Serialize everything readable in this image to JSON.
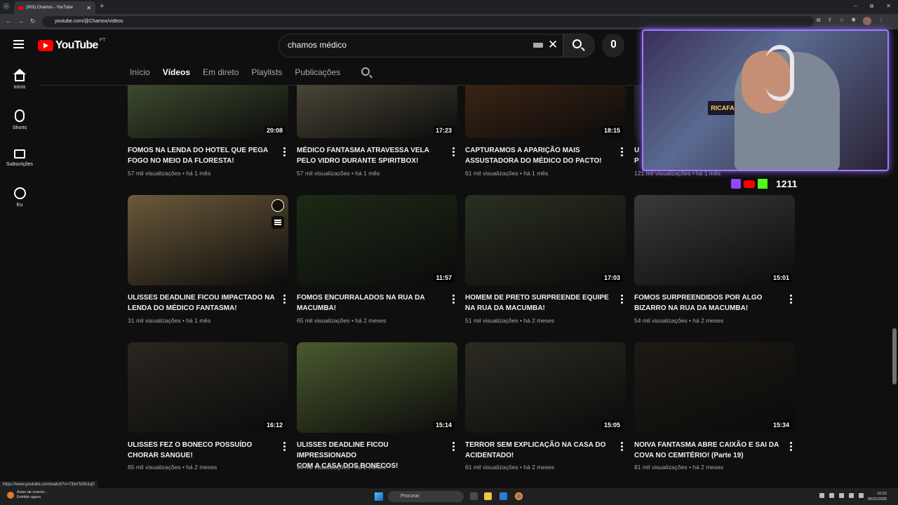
{
  "browser": {
    "tab_title": "(903) Chamos - YouTube",
    "url": "youtube.com/@Chamos/videos",
    "new_tab": "+",
    "tab_close": "✕",
    "win_min": "–",
    "win_max": "⧉",
    "win_close": "✕"
  },
  "header": {
    "logo_text": "YouTube",
    "logo_region": "PT",
    "search_value": "chamos médico"
  },
  "sidebar": {
    "items": [
      {
        "label": "Início",
        "icon": "home-icon"
      },
      {
        "label": "Shorts",
        "icon": "shorts-icon"
      },
      {
        "label": "Subscrições",
        "icon": "subscriptions-icon"
      },
      {
        "label": "Eu",
        "icon": "you-icon"
      }
    ]
  },
  "channel_tabs": [
    {
      "label": "Início",
      "active": false
    },
    {
      "label": "Vídeos",
      "active": true
    },
    {
      "label": "Em direto",
      "active": false
    },
    {
      "label": "Playlists",
      "active": false
    },
    {
      "label": "Publicações",
      "active": false
    }
  ],
  "videos": [
    {
      "title_1": "FOMOS NA LENDA DO HOTEL QUE PEGA",
      "title_2": "FOGO NO MEIO DA FLORESTA!",
      "views": "57 mil visualizações",
      "age": "há 1 mês",
      "duration": "20:08",
      "color": "#3d4a2e"
    },
    {
      "title_1": "MÉDICO FANTASMA ATRAVESSA VELA",
      "title_2": "PELO VIDRO DURANTE SPIRITBOX!",
      "views": "57 mil visualizações",
      "age": "há 1 mês",
      "duration": "17:23",
      "color": "#4a4536"
    },
    {
      "title_1": "CAPTURAMOS A APARIÇÃO MAIS",
      "title_2": "ASSUSTADORA DO MÉDICO DO PACTO!",
      "views": "61 mil visualizações",
      "age": "há 1 mês",
      "duration": "18:15",
      "color": "#3a2414"
    },
    {
      "title_1": "U",
      "title_2": "P",
      "views": "121 mil visualizações",
      "age": "há 1 mês",
      "duration": "",
      "color": "#222"
    },
    {
      "title_1": "ULISSES DEADLINE FICOU IMPACTADO NA",
      "title_2": "LENDA DO MÉDICO FANTASMA!",
      "views": "31 mil visualizações",
      "age": "há 1 mês",
      "duration": "",
      "color": "#6b5a3a"
    },
    {
      "title_1": "FOMOS ENCURRALADOS NA RUA DA",
      "title_2": "MACUMBA!",
      "views": "65 mil visualizações",
      "age": "há 2 meses",
      "duration": "11:57",
      "color": "#1d2a16"
    },
    {
      "title_1": "HOMEM DE PRETO SURPREENDE EQUIPE",
      "title_2": "NA RUA DA MACUMBA!",
      "views": "51 mil visualizações",
      "age": "há 2 meses",
      "duration": "17:03",
      "color": "#2a3020"
    },
    {
      "title_1": "FOMOS SURPREENDIDOS POR ALGO",
      "title_2": "BIZARRO NA RUA DA MACUMBA!",
      "views": "54 mil visualizações",
      "age": "há 2 meses",
      "duration": "15:01",
      "color": "#3a3a3a"
    },
    {
      "title_1": "ULISSES FEZ O BONECO POSSUÍDO",
      "title_2": "CHORAR SANGUE!",
      "views": "65 mil visualizações",
      "age": "há 2 meses",
      "duration": "16:12",
      "color": "#2a2620"
    },
    {
      "title_1": "ULISSES DEADLINE FICOU IMPRESSIONADO",
      "title_2": "COM A CASA DOS BONECOS!",
      "views": "39 mil visualizações",
      "age": "há 2 meses",
      "duration": "15:14",
      "color": "#4a5a2e"
    },
    {
      "title_1": "TERROR SEM EXPLICAÇÃO NA CASA DO",
      "title_2": "ACIDENTADO!",
      "views": "61 mil visualizações",
      "age": "há 2 meses",
      "duration": "15:05",
      "color": "#2c2a22"
    },
    {
      "title_1": "NOIVA FANTASMA ABRE CAIXÃO E SAI DA",
      "title_2": "COVA NO CEMITÉRIO! (Parte 19)",
      "views": "81 mil visualizações",
      "age": "há 2 meses",
      "duration": "15:34",
      "color": "#1e1a14"
    }
  ],
  "overlay": {
    "webcam_sign": "RICAFAZER",
    "viewer_count": "1211"
  },
  "status_url": "https://www.youtube.com/watch?v=73mrTe5h1q0",
  "taskbar": {
    "notification_line1": "Aviso de evento...",
    "notification_line2": "Emitido agora",
    "search_placeholder": "Procurar",
    "time": "10:22",
    "date": "05/11/2025"
  },
  "colors": {
    "brand_red": "#ff0000",
    "accent_purple": "#9c7cff",
    "bg": "#0f0f0f"
  }
}
